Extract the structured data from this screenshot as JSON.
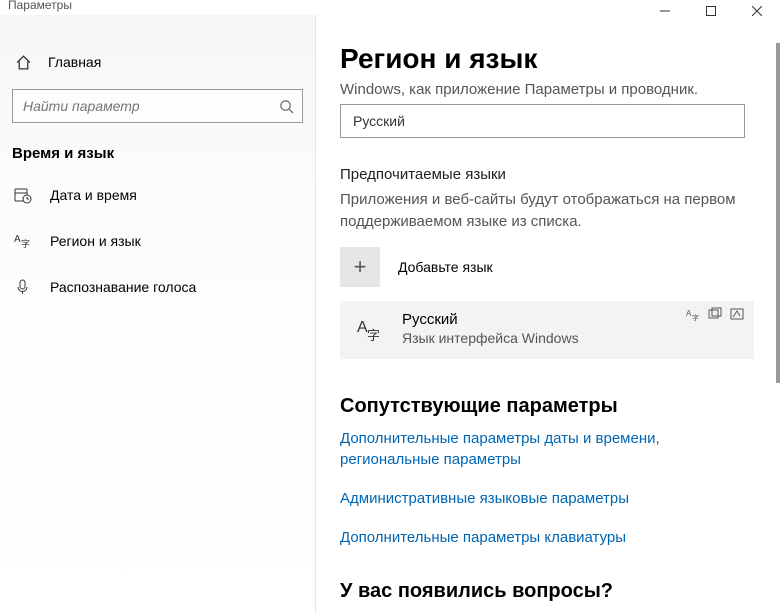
{
  "window": {
    "app_title": "Параметры"
  },
  "sidebar": {
    "home": "Главная",
    "search_placeholder": "Найти параметр",
    "section": "Время и язык",
    "items": [
      {
        "label": "Дата и время"
      },
      {
        "label": "Регион и язык"
      },
      {
        "label": "Распознавание голоса"
      }
    ]
  },
  "main": {
    "title": "Регион и язык",
    "truncated_desc": "Windows, как приложение  Параметры  и проводник.",
    "display_lang_dropdown": "Русский",
    "preferred_heading": "Предпочитаемые языки",
    "preferred_desc": "Приложения и веб-сайты будут отображаться на первом поддерживаемом языке из списка.",
    "add_language": "Добавьте язык",
    "lang_card": {
      "name": "Русский",
      "sub": "Язык интерфейса Windows"
    },
    "related_heading": "Сопутствующие параметры",
    "links": [
      "Дополнительные параметры даты и времени, региональные параметры",
      "Административные языковые параметры",
      "Дополнительные параметры клавиатуры"
    ],
    "questions_heading": "У вас появились вопросы?"
  }
}
